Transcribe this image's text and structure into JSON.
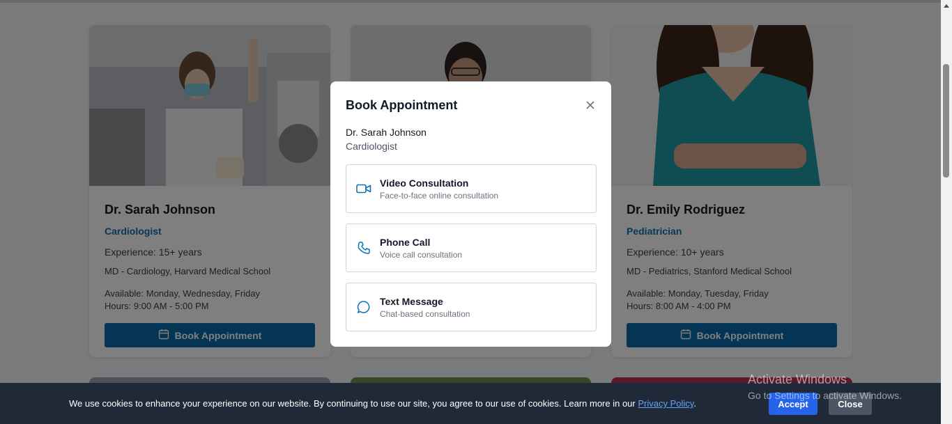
{
  "doctors": [
    {
      "name": "Dr. Sarah Johnson",
      "specialty": "Cardiologist",
      "experience": "Experience: 15+ years",
      "education": "MD - Cardiology, Harvard Medical School",
      "availability": "Available: Monday, Wednesday, Friday",
      "hours": "Hours: 9:00 AM - 5:00 PM",
      "button_label": "Book Appointment"
    },
    {
      "name": "Dr. Emily Rodriguez",
      "specialty": "Pediatrician",
      "experience": "Experience: 10+ years",
      "education": "MD - Pediatrics, Stanford Medical School",
      "availability": "Available: Monday, Tuesday, Friday",
      "hours": "Hours: 8:00 AM - 4:00 PM",
      "button_label": "Book Appointment"
    }
  ],
  "modal": {
    "title": "Book Appointment",
    "doctor_name": "Dr. Sarah Johnson",
    "doctor_specialty": "Cardiologist",
    "options": [
      {
        "icon": "video-icon",
        "title": "Video Consultation",
        "subtitle": "Face-to-face online consultation"
      },
      {
        "icon": "phone-icon",
        "title": "Phone Call",
        "subtitle": "Voice call consultation"
      },
      {
        "icon": "chat-icon",
        "title": "Text Message",
        "subtitle": "Chat-based consultation"
      }
    ]
  },
  "cookie": {
    "message": "We use cookies to enhance your experience on our website. By continuing to use our site, you agree to our use of cookies. Learn more in our",
    "link": "Privacy Policy",
    "end": ".",
    "accept": "Accept",
    "close": "Close"
  },
  "watermark": {
    "line1": "Activate Windows",
    "line2": "Go to Settings to activate Windows."
  },
  "colors": {
    "primary": "#0b6aa8",
    "specialty": "#0b73b3",
    "accept": "#2563eb",
    "cookie_bg": "#1f2937"
  }
}
